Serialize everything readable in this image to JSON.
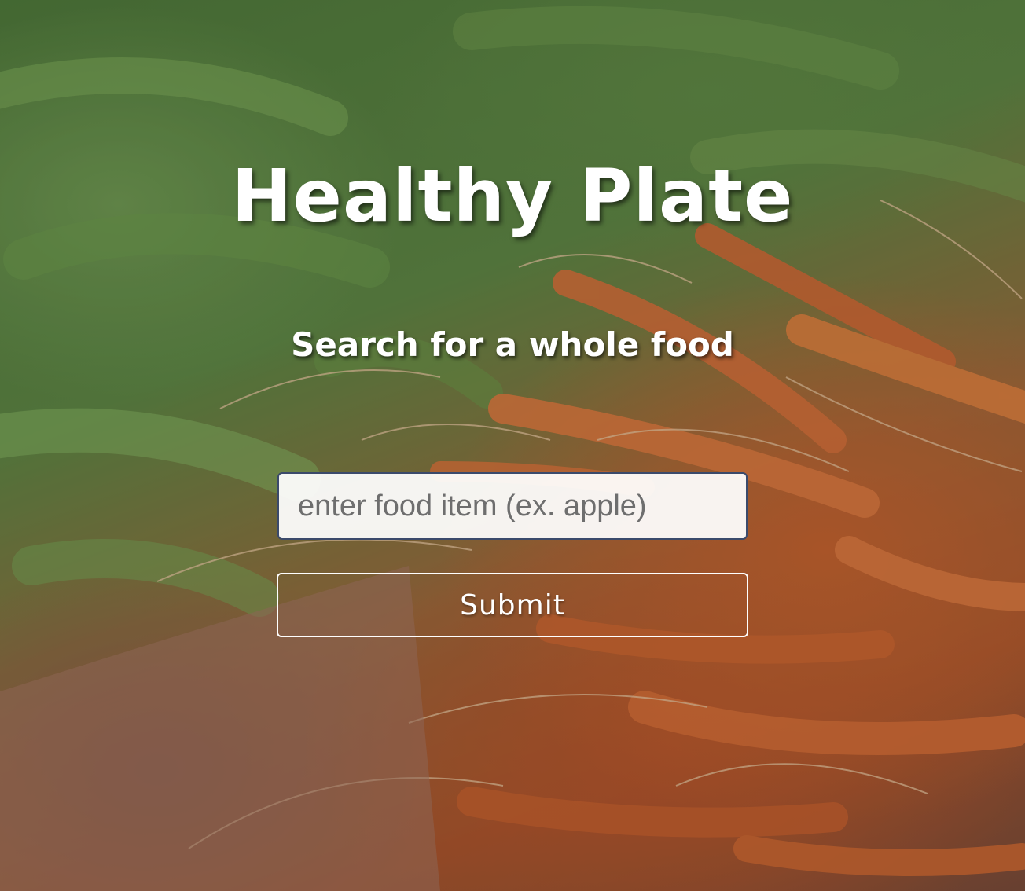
{
  "page": {
    "title": "Healthy Plate",
    "subtitle": "Search for a whole food"
  },
  "search": {
    "value": "",
    "placeholder": "enter food item (ex. apple)"
  },
  "actions": {
    "submit_label": "Submit"
  },
  "background": {
    "description_icon": "carrots-and-peas-photo",
    "colors": {
      "green": "#5d8744",
      "orange": "#c8622e",
      "text": "#ffffff",
      "input_border": "#3b4a6b"
    }
  }
}
